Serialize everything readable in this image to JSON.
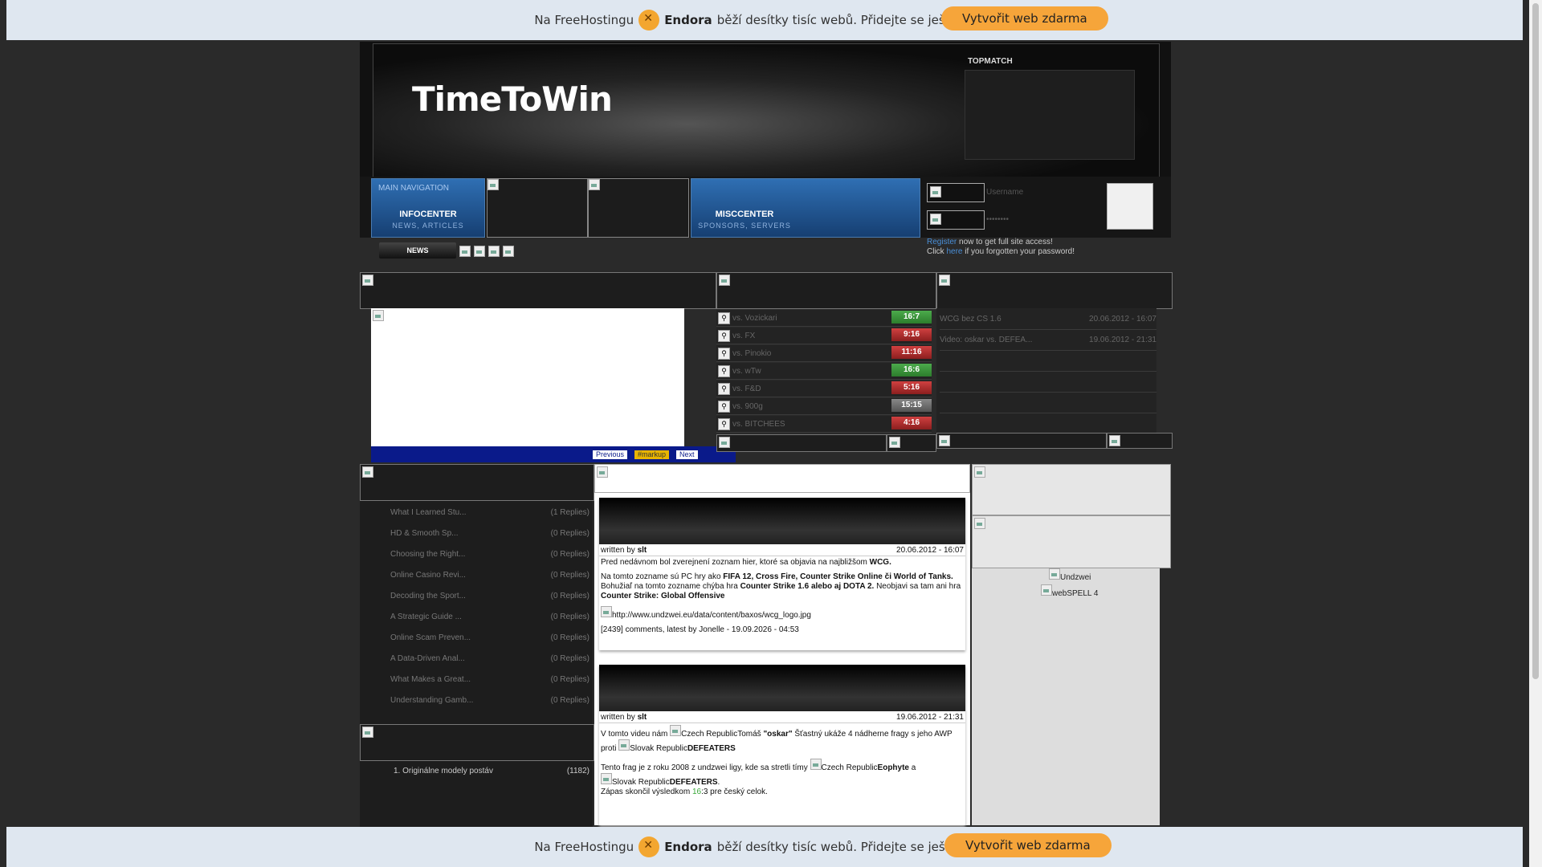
{
  "promo": {
    "text_before": "Na FreeHostingu",
    "brand": "Endora",
    "text_after": "běží desítky tisíc webů. Přidejte se ještě dnes!",
    "button": "Vytvořit web zdarma",
    "accent": "#f6a53a"
  },
  "header": {
    "site_title": "TimeToWin",
    "topmatch_label": "TOPMATCH"
  },
  "nav": {
    "main_label": "MAIN NAVIGATION",
    "info_title": "INFOCENTER",
    "info_sub": "NEWS, ARTICLES",
    "misc_title": "MISCCENTER",
    "misc_sub": "SPONSORS, SERVERS",
    "news_button": "NEWS"
  },
  "login": {
    "username_label": "Username",
    "password_label": "••••••••",
    "register_link": "Register",
    "register_text": " now to get full site access!",
    "forgot_prefix": "Click ",
    "forgot_link": "here",
    "forgot_suffix": " if you forgotten your password!"
  },
  "slideshow": {
    "previous": "Previous",
    "markup": "#markup",
    "next": "Next"
  },
  "matches": [
    {
      "opponent": "vs. Vozickari",
      "score": "16:7",
      "result": "win"
    },
    {
      "opponent": "vs. FX",
      "score": "9:16",
      "result": "loss"
    },
    {
      "opponent": "vs. Pinokio",
      "score": "11:16",
      "result": "loss"
    },
    {
      "opponent": "vs. wTw",
      "score": "16:6",
      "result": "win"
    },
    {
      "opponent": "vs. F&D",
      "score": "5:16",
      "result": "loss"
    },
    {
      "opponent": "vs. 900g",
      "score": "15:15",
      "result": "draw"
    },
    {
      "opponent": "vs. BITCHEES",
      "score": "4:16",
      "result": "loss"
    }
  ],
  "latest_news": [
    {
      "title": "WCG bez CS 1.6",
      "date": "20.06.2012 - 16:07"
    },
    {
      "title": "Video: oskar vs. DEFEA...",
      "date": "19.06.2012 - 21:31"
    }
  ],
  "forum_topics": [
    {
      "title": "What I Learned Stu...",
      "replies": "(1 Replies)"
    },
    {
      "title": "HD & Smooth Sp...",
      "replies": "(0 Replies)"
    },
    {
      "title": "Choosing the Right...",
      "replies": "(0 Replies)"
    },
    {
      "title": "Online Casino Revi...",
      "replies": "(0 Replies)"
    },
    {
      "title": "Decoding the Sport...",
      "replies": "(0 Replies)"
    },
    {
      "title": "A Strategic Guide ...",
      "replies": "(0 Replies)"
    },
    {
      "title": "Online Scam Preven...",
      "replies": "(0 Replies)"
    },
    {
      "title": "A Data-Driven Anal...",
      "replies": "(0 Replies)"
    },
    {
      "title": "What Makes a Great...",
      "replies": "(0 Replies)"
    },
    {
      "title": "Understanding Gamb...",
      "replies": "(0 Replies)"
    }
  ],
  "files": [
    {
      "title": "1. Originálne modely postáv",
      "count": "(1182)"
    }
  ],
  "posts": [
    {
      "author_prefix": "written by ",
      "author": "slt",
      "date": "20.06.2012 - 16:07",
      "p1_a": "Pred nedávnom bol zverejnení zoznam hier, ktoré sa objavia na najbližšom ",
      "p1_b": "WCG.",
      "p2_a": "Na tomto zozname sú PC hry ako ",
      "p2_b": "FIFA 12, Cross Fire, Counter Strike Online či World of Tanks.",
      "p2_c": " Bohužiaľ na tomto zozname chýba hra ",
      "p2_d": "Counter Strike 1.6 alebo aj DOTA 2.",
      "p2_e": " Neobjavi sa tam ani hra ",
      "p2_f": "Counter Strike: Global Offensive",
      "img_alt": "http://www.undzwei.eu/data/content/baxos/wcg_logo.jpg",
      "comments": "[2439]",
      "comments_text": " comments, ",
      "latest": "latest by Jonelle - 19.09.2026 - 04:53"
    },
    {
      "author_prefix": "written by ",
      "author": "slt",
      "date": "19.06.2012 - 21:31",
      "l1_a": "V tomto videu nám ",
      "l1_flag": "Czech Republic",
      "l1_b": "Tomáš ",
      "l1_c": "\"oskar\"",
      "l1_d": " Šťastný ukáže 4 nádherne fragy s jeho AWP",
      "l2_a": "proti ",
      "l2_flag": "Slovak Republic",
      "l2_b": "DEFEATERS",
      "l3_a": "Tento frag je z roku 2008 z undzwei ligy, kde sa stretli tímy ",
      "l3_flag": "Czech Republic",
      "l3_b": "Eophyte",
      "l3_c": " a",
      "l4_flag": "Slovak Republic",
      "l4_b": "DEFEATERS",
      "l4_c": ".",
      "l5_a": "Zápas skončil výsledkom ",
      "l5_s1": "16",
      "l5_s2": ":3",
      "l5_b": " pre český celok."
    }
  ],
  "sponsors": [
    "Undzwei",
    "webSPELL 4"
  ]
}
